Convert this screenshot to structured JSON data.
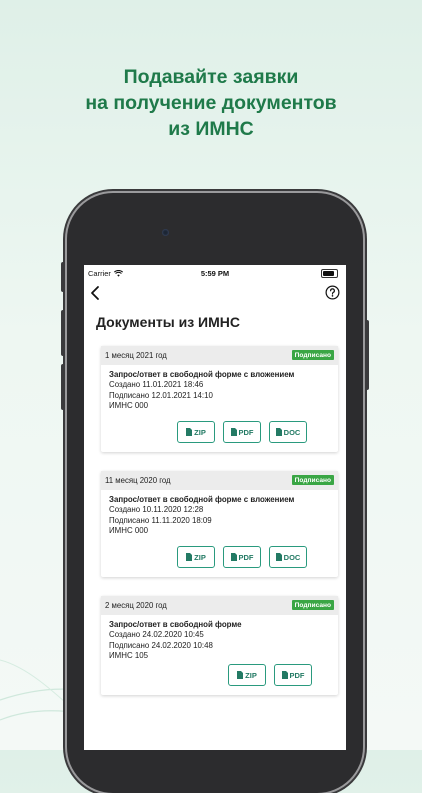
{
  "headline": [
    "Подавайте заявки",
    "на получение документов",
    "из ИМНС"
  ],
  "status_bar": {
    "carrier": "Carrier",
    "time": "5:59 PM"
  },
  "page_title": "Документы из ИМНС",
  "cards": [
    {
      "month": "1 месяц 2021 год",
      "badge": "Подписано",
      "doc_title": "Запрос/ответ в свободной форме с вложением",
      "created": "Создано 11.01.2021 18:46",
      "signed": "Подписано 12.01.2021 14:10",
      "authority": "ИМНС 000",
      "buttons": [
        "ZIP",
        "PDF",
        "DOC"
      ]
    },
    {
      "month": "11 месяц 2020 год",
      "badge": "Подписано",
      "doc_title": "Запрос/ответ в свободной форме с вложением",
      "created": "Создано 10.11.2020 12:28",
      "signed": "Подписано 11.11.2020 18:09",
      "authority": "ИМНС 000",
      "buttons": [
        "ZIP",
        "PDF",
        "DOC"
      ]
    },
    {
      "month": "2 месяц 2020 год",
      "badge": "Подписано",
      "doc_title": "Запрос/ответ в свободной форме",
      "created": "Создано 24.02.2020 10:45",
      "signed": "Подписано 24.02.2020 10:48",
      "authority": "ИМНС 105",
      "buttons": [
        "ZIP",
        "PDF"
      ]
    }
  ],
  "colors": {
    "brand_green": "#1f7a4a",
    "badge_green": "#3aa645",
    "button_teal": "#2a9a7e"
  },
  "icons": {
    "back": "chevron-left-icon",
    "help": "question-circle-icon",
    "file": "file-icon"
  }
}
